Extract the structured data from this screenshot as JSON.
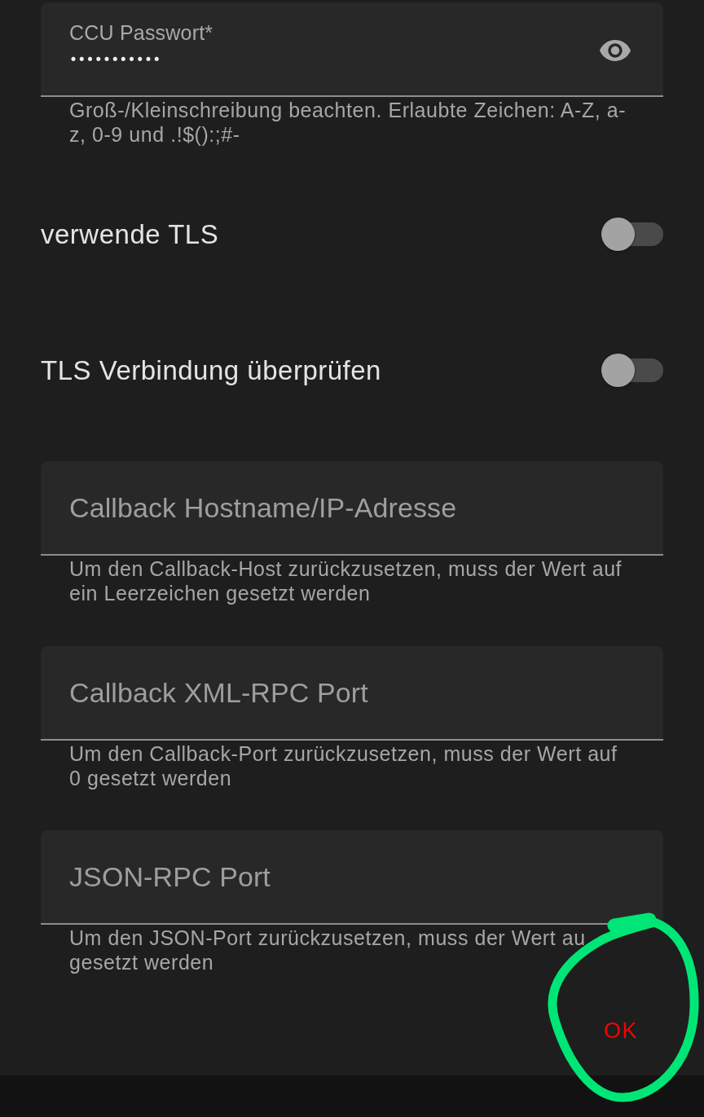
{
  "password_field": {
    "label": "CCU Passwort*",
    "value": "•••••••••••",
    "helper": "Groß-/Kleinschreibung beachten. Erlaubte Zeichen: A-Z, a-z, 0-9 und .!$():;#-"
  },
  "switches": [
    {
      "label": "verwende TLS",
      "on": false
    },
    {
      "label": "TLS Verbindung überprüfen",
      "on": false
    }
  ],
  "fields": [
    {
      "placeholder": "Callback Hostname/IP-Adresse",
      "helper": "Um den Callback-Host zurückzusetzen, muss der Wert auf ein Leerzeichen gesetzt werden"
    },
    {
      "placeholder": "Callback XML-RPC Port",
      "helper": "Um den Callback-Port zurückzusetzen, muss der Wert auf 0 gesetzt werden"
    },
    {
      "placeholder": "JSON-RPC Port",
      "helper": "Um den JSON-Port zurückzusetzen, muss der Wert au gesetzt werden"
    }
  ],
  "actions": [
    {
      "label": "OK"
    }
  ]
}
